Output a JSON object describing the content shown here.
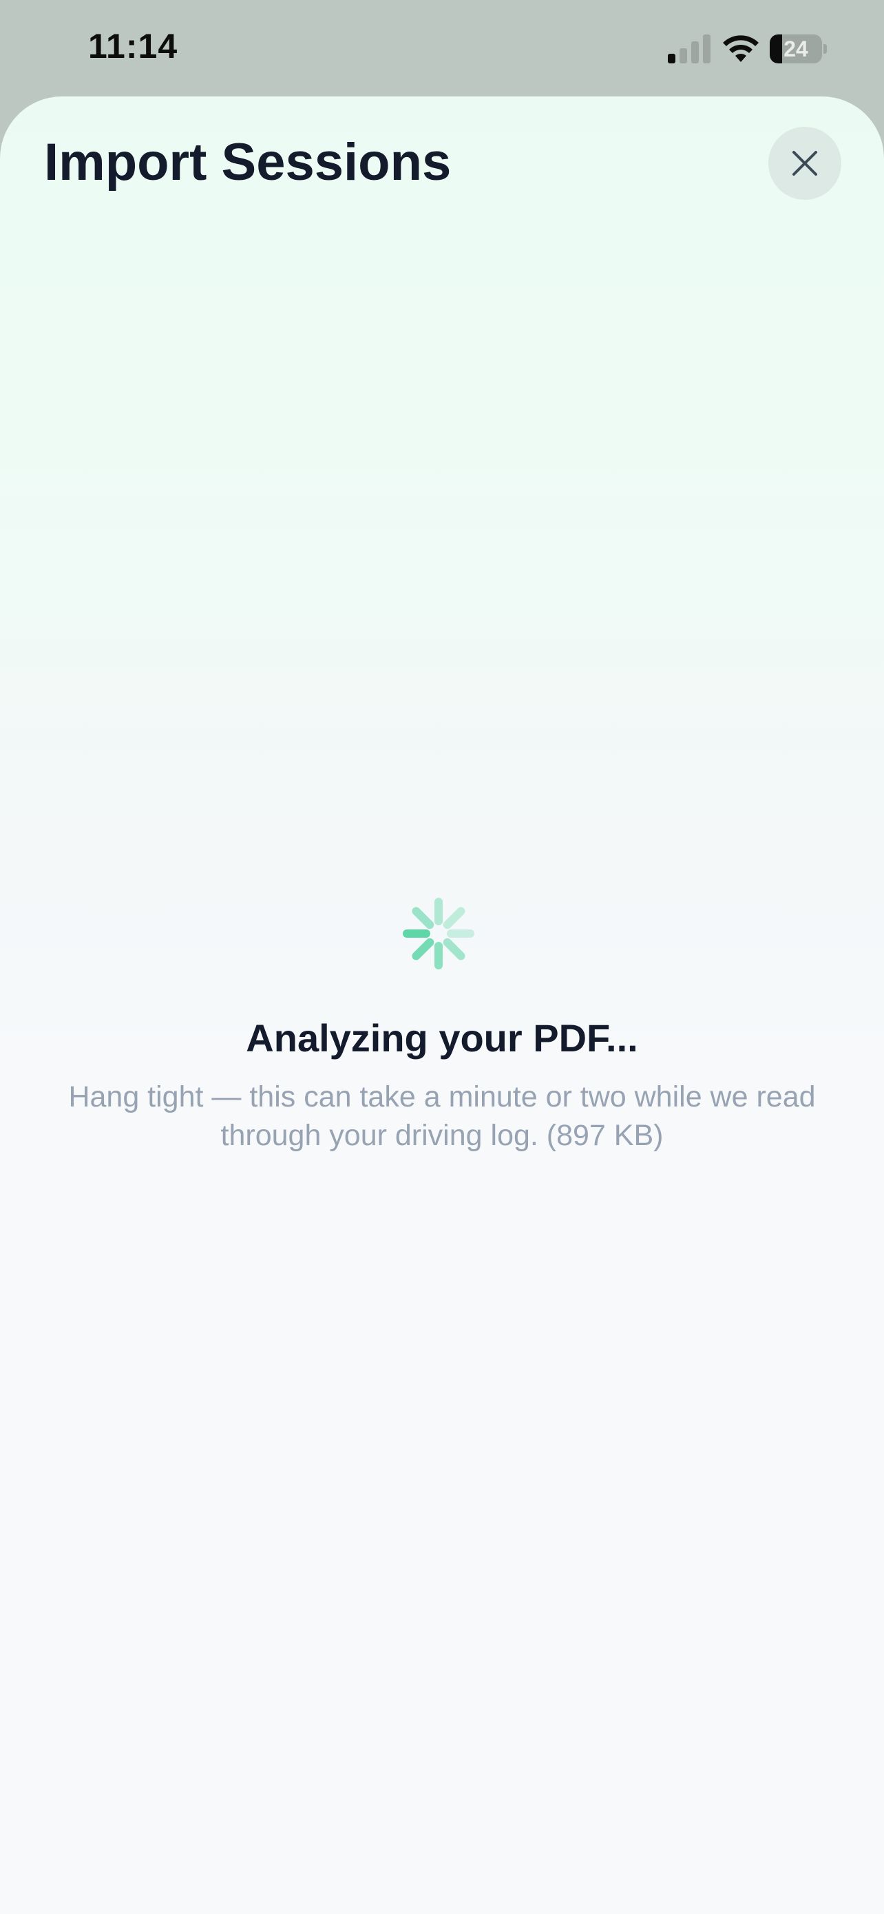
{
  "status_bar": {
    "time": "11:14",
    "battery_level": "24",
    "battery_fraction": 0.24,
    "signal_bars_active": 1,
    "signal_bars_total": 4,
    "icons": [
      "signal-icon",
      "wifi-icon",
      "battery-icon"
    ]
  },
  "sheet": {
    "title": "Import Sessions",
    "close_icon": "close-icon"
  },
  "loading": {
    "spinner_icon": "spinner-icon",
    "title": "Analyzing your PDF...",
    "description": "Hang tight — this can take a minute or two while we read through your driving log. (897 KB)"
  },
  "colors": {
    "accent": "#5fd6a8",
    "title_text": "#141b2d",
    "muted_text": "#97a3b3",
    "close_button_bg": "#dde9e4",
    "status_bar_bg": "#bcc7c1"
  }
}
